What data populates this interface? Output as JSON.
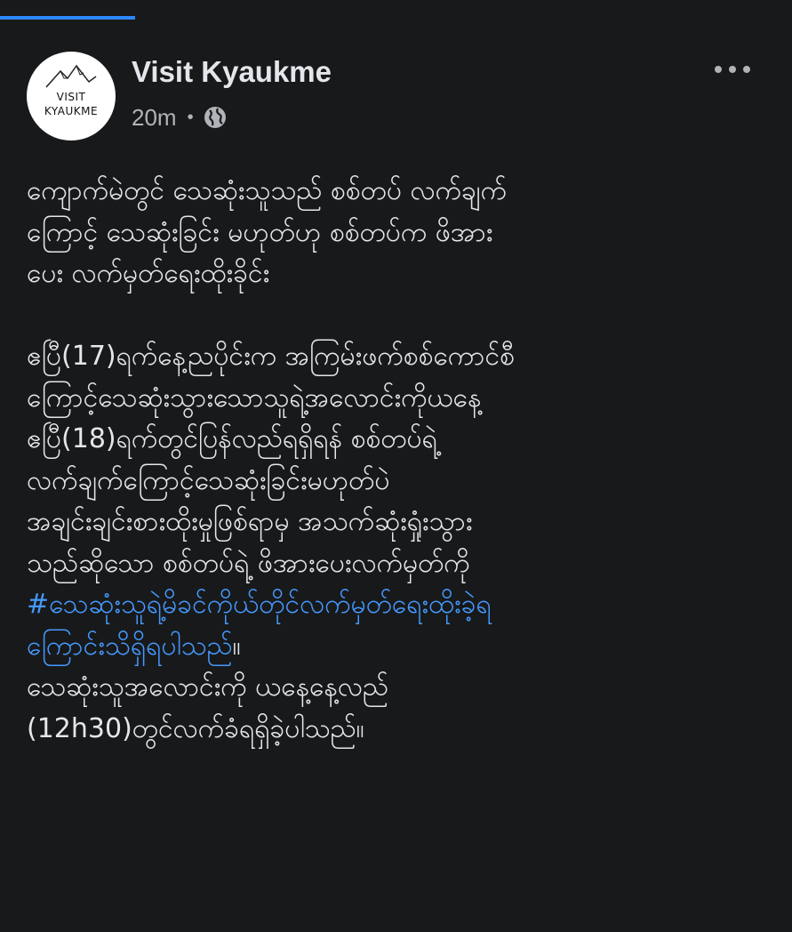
{
  "post": {
    "page_name": "Visit Kyaukme",
    "time": "20m",
    "separator": "•",
    "audience_icon": "globe-icon",
    "more_icon": "more-options-icon",
    "avatar": {
      "logo_line1": "VISIT",
      "logo_line2": "KYAUKME"
    },
    "paragraph1": [
      "ကျောက်မဲတွင် သေဆုံးသူသည် စစ်တပ် လက်ချက်",
      "ကြောင့် သေဆုံးခြင်း မဟုတ်ဟု စစ်တပ်က ဖိအား",
      "ပေး လက်မှတ်ရေးထိုးခိုင်း"
    ],
    "paragraph2": [
      "ဧပြီ(17)ရက်နေ့ညပိုင်းက အကြမ်းဖက်စစ်ကောင်စီ",
      "ကြောင့်သေဆုံးသွားသောသူရဲ့အလောင်းကိုယနေ့",
      "ဧပြီ(18)ရက်တွင်ပြန်လည်ရရှိရန် စစ်တပ်ရဲ့",
      "လက်ချက်ကြောင့်သေဆုံးခြင်းမဟုတ်ပဲ",
      "အချင်းချင်းစားထိုးမှုဖြစ်ရာမှ အသက်ဆုံးရှုံးသွား",
      "သည်ဆိုသော စစ်တပ်ရဲ့ ဖိအားပေးလက်မှတ်ကို"
    ],
    "hashtag_line1": "#သေဆုံးသူရဲ့မိခင်ကိုယ်တိုင်လက်မှတ်ရေးထိုးခဲ့ရ",
    "hashtag_line2": "ကြောင်းသိရှိရပါသည်",
    "hashtag_line2_suffix": "။",
    "paragraph3": [
      "သေဆုံးသူအလောင်းကို ယနေ့နေ့လည်",
      "(12h30)တွင်လက်ခံရရှိခဲ့ပါသည်။"
    ]
  },
  "colors": {
    "background": "#18191a",
    "text_primary": "#e4e6eb",
    "text_secondary": "#b0b3b8",
    "link": "#4599ff",
    "progress": "#2d88ff"
  }
}
